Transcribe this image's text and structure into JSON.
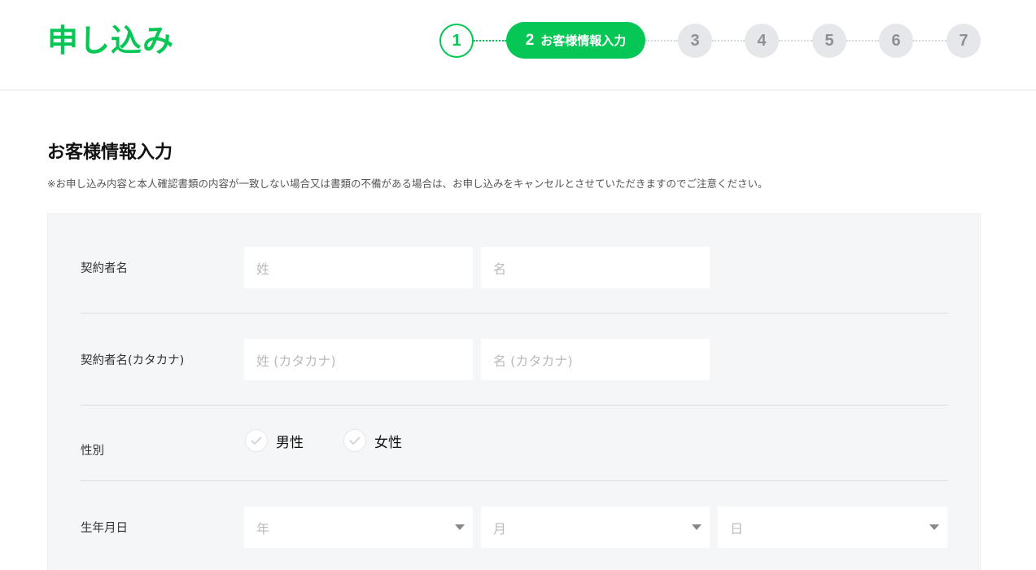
{
  "header": {
    "title": "申し込み",
    "steps": [
      {
        "number": "1",
        "state": "done"
      },
      {
        "number": "2",
        "label": "お客様情報入力",
        "state": "current"
      },
      {
        "number": "3",
        "state": "todo"
      },
      {
        "number": "4",
        "state": "todo"
      },
      {
        "number": "5",
        "state": "todo"
      },
      {
        "number": "6",
        "state": "todo"
      },
      {
        "number": "7",
        "state": "todo"
      }
    ]
  },
  "section": {
    "title": "お客様情報入力",
    "notice": "※お申し込み内容と本人確認書類の内容が一致しない場合又は書類の不備がある場合は、お申し込みをキャンセルとさせていただきますのでご注意ください。"
  },
  "form": {
    "name": {
      "label": "契約者名",
      "last_placeholder": "姓",
      "first_placeholder": "名"
    },
    "kana": {
      "label": "契約者名(カタカナ)",
      "last_placeholder": "姓 (カタカナ)",
      "first_placeholder": "名 (カタカナ)"
    },
    "gender": {
      "label": "性別",
      "options": [
        "男性",
        "女性"
      ]
    },
    "birthdate": {
      "label": "生年月日",
      "year_placeholder": "年",
      "month_placeholder": "月",
      "day_placeholder": "日"
    }
  },
  "colors": {
    "accent": "#06c755",
    "step_inactive_bg": "#e6e7eb",
    "panel_bg": "#f5f6f7"
  }
}
